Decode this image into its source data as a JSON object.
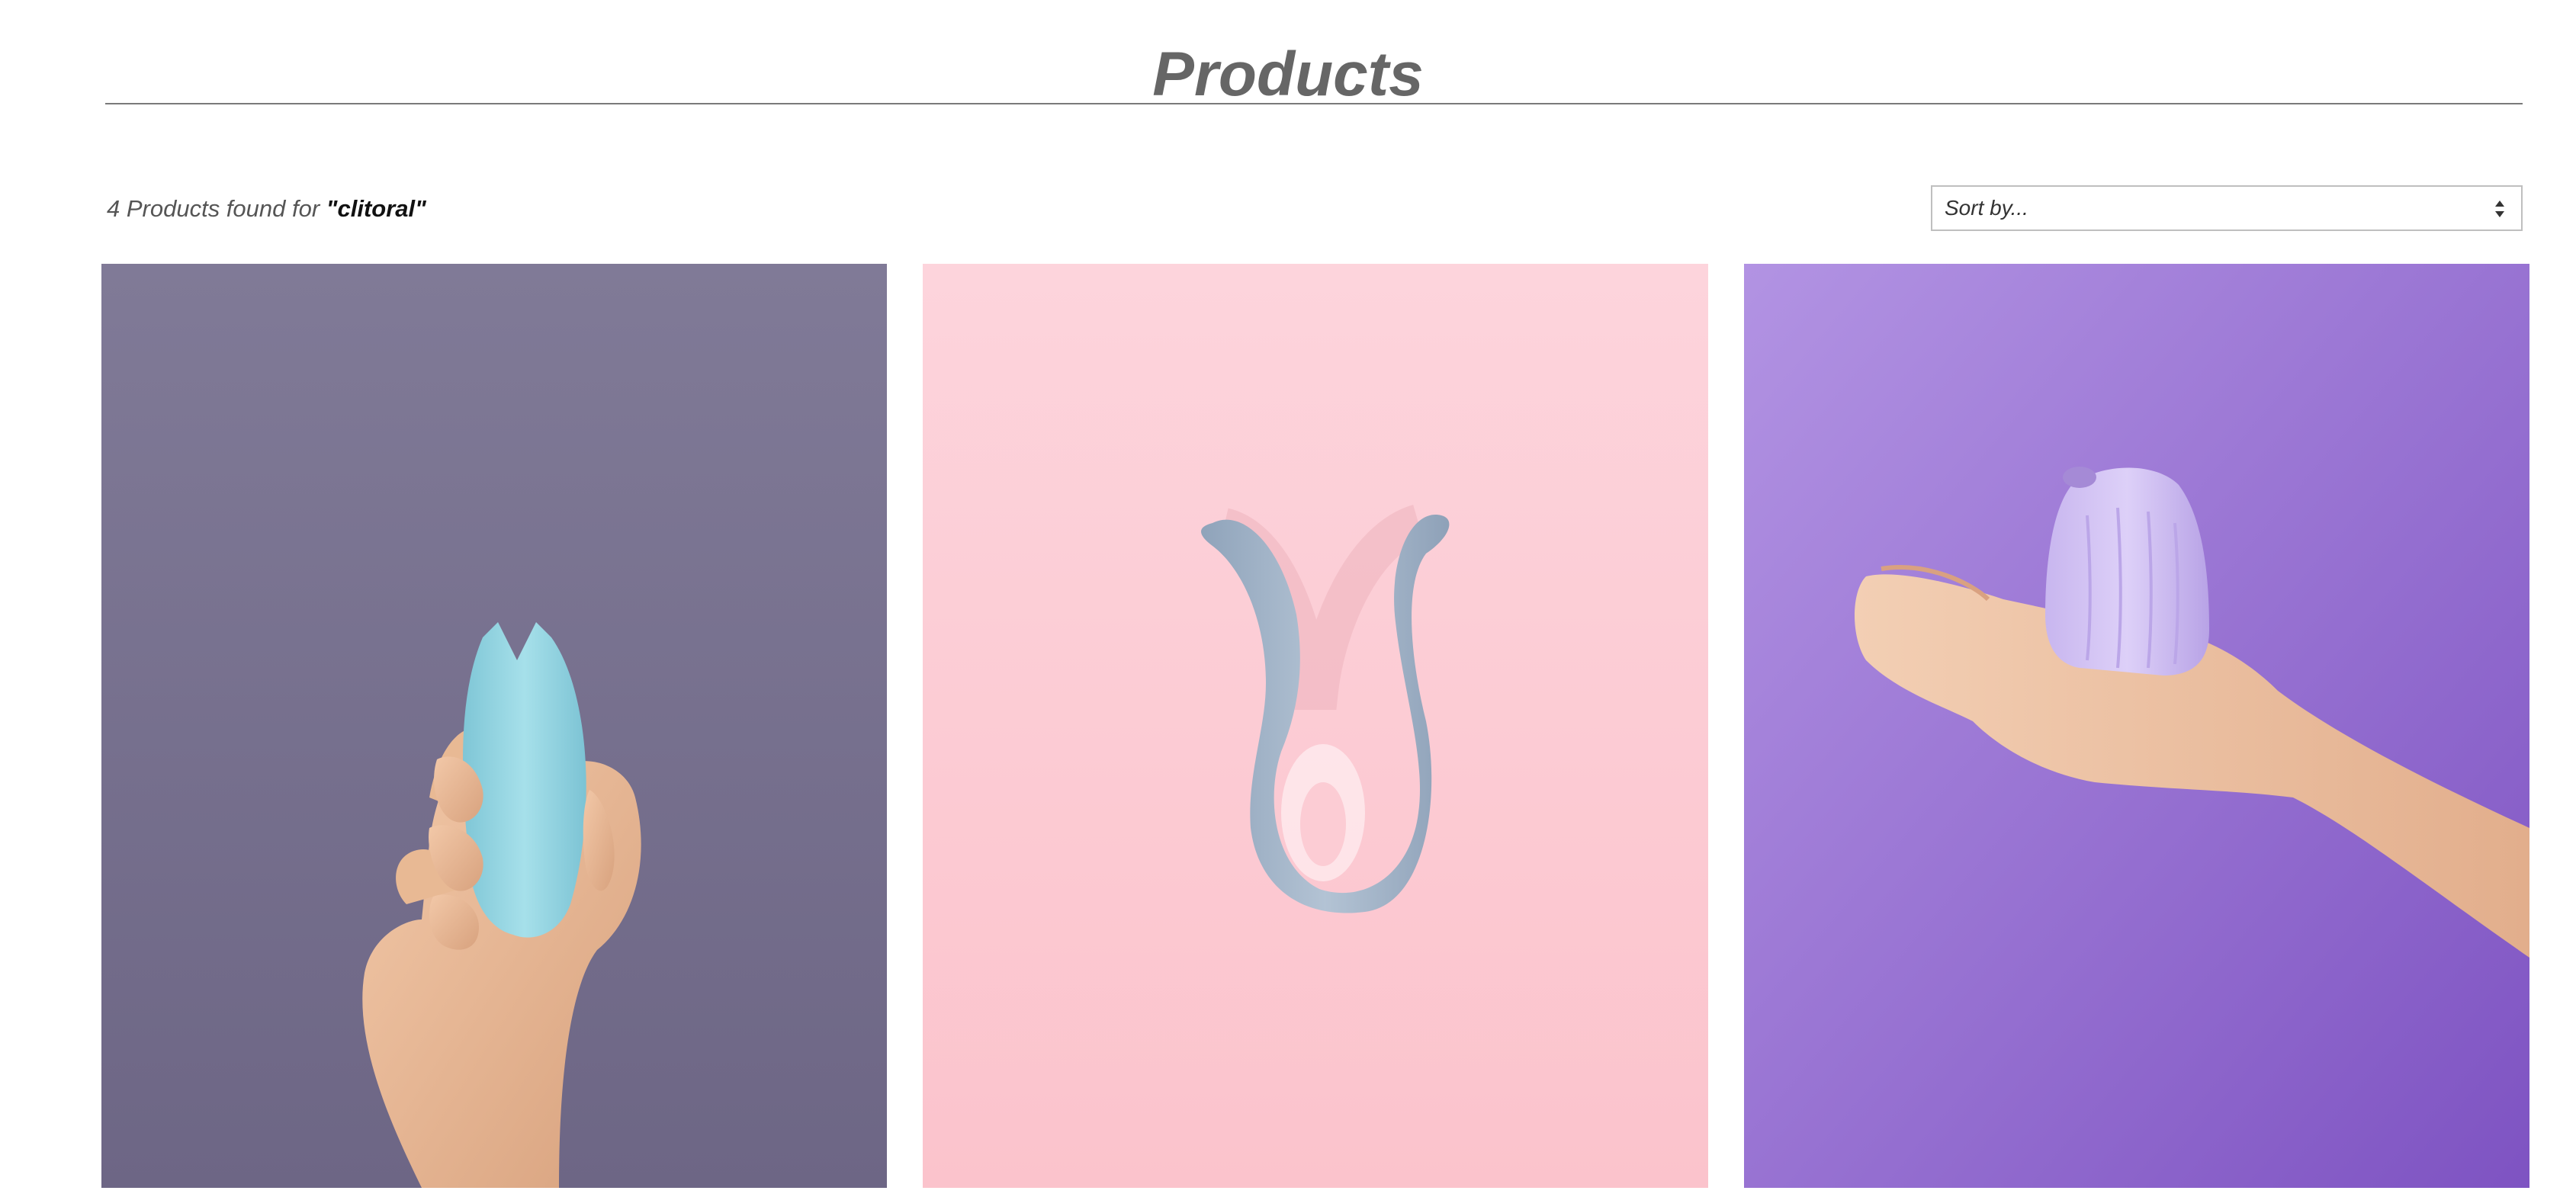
{
  "header": {
    "title": "Products"
  },
  "results": {
    "count_text": "4 Products found for ",
    "query_text": "\"clitoral\""
  },
  "sort": {
    "placeholder": "Sort by..."
  },
  "products": [
    {
      "image": "product-photo-light-blue-vibrator-in-hand",
      "background": "#77708f"
    },
    {
      "image": "product-photo-grey-u-shaped-vibrator",
      "background": "#fdc9d2"
    },
    {
      "image": "product-photo-lilac-suction-toy-on-palm",
      "background": "#9d7ad9"
    }
  ]
}
